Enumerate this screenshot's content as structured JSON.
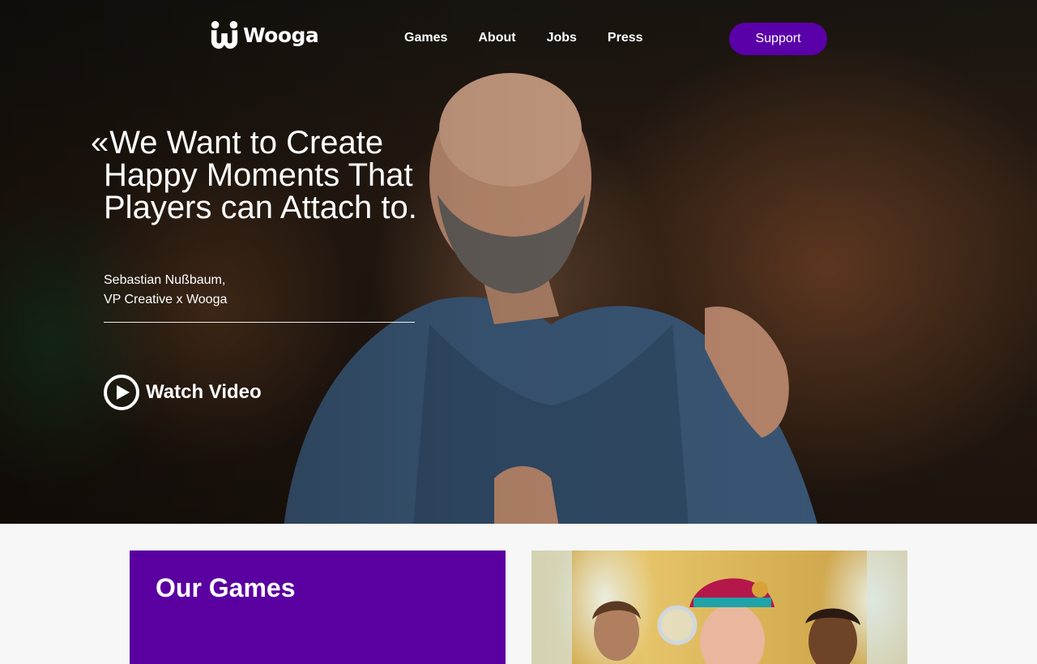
{
  "nav": {
    "logo_text": "Wooga",
    "links": [
      {
        "label": "Games"
      },
      {
        "label": "About"
      },
      {
        "label": "Jobs"
      },
      {
        "label": "Press"
      }
    ],
    "support_label": "Support"
  },
  "hero": {
    "quote_mark": "«",
    "quote": "We Want to Create Happy Moments That Players can Attach to.",
    "author_name": "Sebastian Nußbaum,",
    "author_role": "VP Creative x Wooga",
    "watch_label": "Watch Video"
  },
  "games": {
    "title": "Our Games"
  },
  "colors": {
    "brand_purple": "#5a00a0",
    "button_purple": "#5a00a8",
    "text_light": "#ffffff",
    "page_bg": "#f7f7f7"
  },
  "icons": {
    "logo": "wooga-logo-icon",
    "play": "play-circle-icon"
  }
}
